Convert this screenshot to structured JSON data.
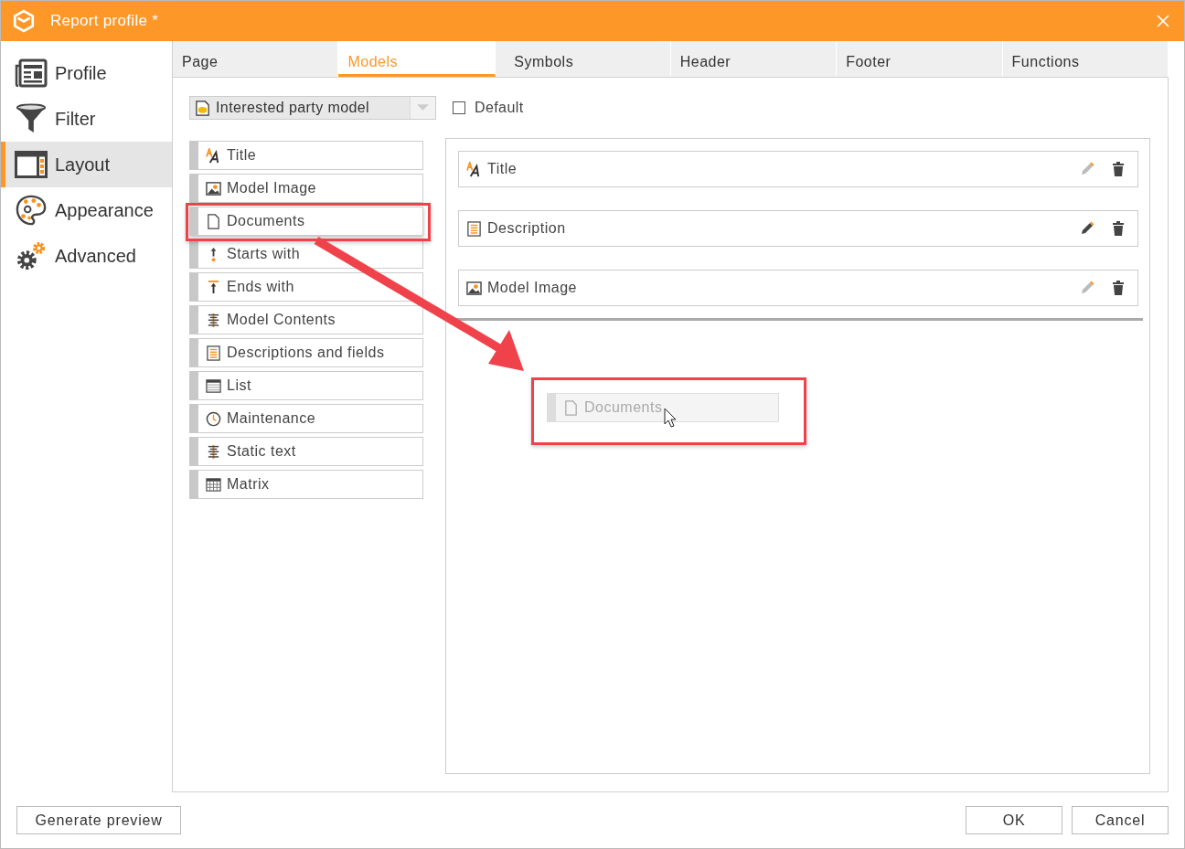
{
  "window": {
    "title": "Report profile *"
  },
  "sidebar": {
    "items": [
      {
        "label": "Profile",
        "selected": false
      },
      {
        "label": "Filter",
        "selected": false
      },
      {
        "label": "Layout",
        "selected": true
      },
      {
        "label": "Appearance",
        "selected": false
      },
      {
        "label": "Advanced",
        "selected": false
      }
    ]
  },
  "tabs": [
    {
      "label": "Page",
      "selected": false
    },
    {
      "label": "Models",
      "selected": true
    },
    {
      "label": "Symbols",
      "selected": false
    },
    {
      "label": "Header",
      "selected": false
    },
    {
      "label": "Footer",
      "selected": false
    },
    {
      "label": "Functions",
      "selected": false
    }
  ],
  "model_select": {
    "value": "Interested party model"
  },
  "default_checkbox": {
    "label": "Default",
    "checked": false
  },
  "palette": [
    {
      "label": "Title",
      "highlighted": false
    },
    {
      "label": "Model Image",
      "highlighted": false
    },
    {
      "label": "Documents",
      "highlighted": true
    },
    {
      "label": "Starts with",
      "highlighted": false
    },
    {
      "label": "Ends with",
      "highlighted": false
    },
    {
      "label": "Model Contents",
      "highlighted": false
    },
    {
      "label": "Descriptions and fields",
      "highlighted": false
    },
    {
      "label": "List",
      "highlighted": false
    },
    {
      "label": "Maintenance",
      "highlighted": false
    },
    {
      "label": "Static text",
      "highlighted": false
    },
    {
      "label": "Matrix",
      "highlighted": false
    }
  ],
  "layout_items": [
    {
      "label": "Title",
      "editable": false
    },
    {
      "label": "Description",
      "editable": true
    },
    {
      "label": "Model Image",
      "editable": false
    }
  ],
  "drag_ghost": {
    "label": "Documents"
  },
  "buttons": {
    "left": [
      "Generate preview"
    ],
    "right": [
      "OK",
      "Cancel"
    ]
  }
}
